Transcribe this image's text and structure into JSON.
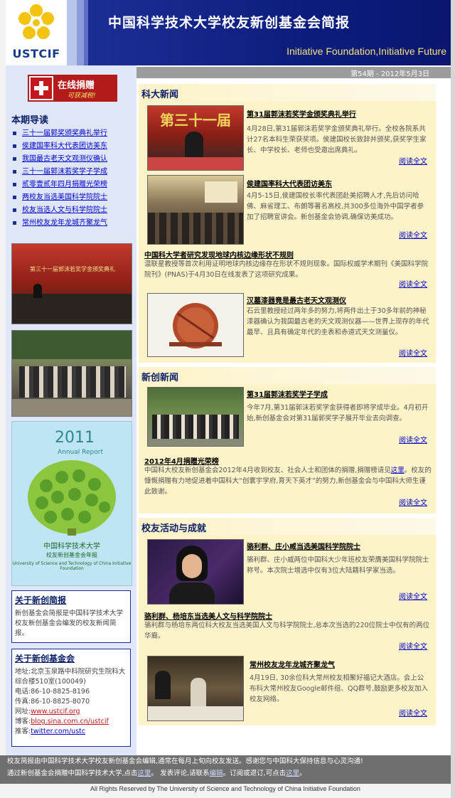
{
  "header": {
    "logo_text": "USTCIF",
    "title": "中国科学技术大学校友新创基金会简报",
    "subtitle": "Initiative Foundation,Initiative Future",
    "colors": {
      "banner": "#0b1d7c",
      "subtitle": "#f6e27a"
    }
  },
  "issue_line": "第54期 - 2012年5月3日",
  "sidebar": {
    "donate": {
      "label": "在线捐赠",
      "tagline": "可获减税!"
    },
    "toc_title": "本期导读",
    "toc_items": [
      "三十一届郭奖颁奖典礼举行",
      "侯建国率科大代表团访美东",
      "我国最古老天文观测仪确认",
      "三十一届郭沫若奖学子学成",
      "贰零壹贰年四月捐赠光荣榜",
      "两校友当选美国科学院院士",
      "校友当选人文与科学院院士",
      "常州校友龙年龙城齐聚龙气"
    ],
    "photo1_text": "第三十一届郭沫若奖学金颁奖典礼",
    "annual_report": {
      "year": "2011",
      "label": "Annual Report",
      "cn_title": "中国科学技术大学",
      "cn_sub": "校友新创基金会年报",
      "en": "University of Science and Technology of China Initiative Foundation"
    },
    "about_brief": {
      "title": "关于新创简报",
      "text": "新创基金会简报是中国科学技术大学校友新创基金会编发的校友新闻简报。"
    },
    "about_foundation": {
      "title": "关于新创基金会",
      "address_label": "地址:",
      "address": "北京玉泉路中科院研究生院科大综合楼510室(100049)",
      "phone_label": "电话:",
      "phone": "86-10-8825-8196",
      "fax_label": "传真:",
      "fax": "86-10-8825-8070",
      "web_label": "网址:",
      "web": "www.ustcif.org",
      "blog_label": "博客:",
      "blog": "blog.sina.com.cn/ustcif",
      "tweet_label": "推客:",
      "tweet": "twitter.com/ustc"
    }
  },
  "sections": {
    "s1": {
      "title": "科大新闻",
      "a1": {
        "title": "第31届郭沫若奖学金颁奖典礼举行",
        "body": "4月28日,第31届郭沫若奖学金颁奖典礼举行。全校各院系共计27名本科生荣获奖项。侯建国校长致辞并颁奖,获奖学生家长、中学校长、老师也受邀出席典礼。",
        "read": "阅读全文",
        "photo_text": "第三十一届"
      },
      "a2": {
        "title": "侯建国率科大代表团访美东",
        "body": "4月5-15日,侯建国校长率代表团赴美招聘人才,先后访问哈佛、麻省理工、布朗等著名高校,共300多位海外中国学者参加了招聘宣讲会。新创基金会协调,确保访美成功。",
        "read": "阅读全文"
      },
      "a3": {
        "title": "中国科大学者研究发现地球内核边缘形状不规则",
        "body": "温联星教授等首次利用证明地球内核边缘存在形状不规则现象。国际权威学术期刊《美国科学院院刊》(PNAS)于4月30日在线发表了这项研究成果。",
        "read": "阅读全文"
      },
      "a4": {
        "title": "汉墓漆器竟是最古老天文观测仪",
        "body": "石云里教授经过两年多的努力,将两件出土于30多年前的神秘漆器确认为我国最古老的天文观测仪器——世界上现存的年代最早、且具有确定年代的圭表和赤道式天文测量仪。",
        "read": "阅读全文"
      }
    },
    "s2": {
      "title": "新创新闻",
      "a1": {
        "title": "第31届郭沫若奖学子学成",
        "body": "今年7月,第31届郭沫若奖学金获得者即将学成毕业。4月初开始,新创基金会对第31届郭奖学子展开毕业去向调查。",
        "read": "阅读全文"
      },
      "a2": {
        "title": "2012年4月捐赠光荣榜",
        "body_1": "中国科大校友新创基金会2012年4月收到校友、社会人士和团体的捐赠,捐赠榜请见",
        "body_link": "这里",
        "body_2": "。校友的慷慨捐赠有力地促进着中国科大“创寰宇学府,育天下英才”的努力,新创基金会与中国科大师生谨此致谢。",
        "read": "阅读全文"
      }
    },
    "s3": {
      "title": "校友活动与成就",
      "a1": {
        "title": "骆利群、庄小威当选美国科学院院士",
        "body": "骆利群、庄小威两位中国科大少年班校友荣膺美国科学院院士称号。本次院士增选中仅有3位大陆籍科学家当选。",
        "read": "阅读全文"
      },
      "a2": {
        "title": "骆利群、杨培东当选美人文与科学院院士",
        "body": "骆利群与杨培东两位科大校友当选美国人文与科学院院士,总本次当选的220位院士中仅有的两位华裔。",
        "read": "阅读全文"
      },
      "a3": {
        "title": "常州校友龙年龙城齐聚龙气",
        "body": "4月19日, 30余位科大常州校友相聚好福记大酒店。会上公布科大常州校友Google邮件组、QQ群号,鼓励更多校友加入校友网络。",
        "read": "阅读全文"
      }
    }
  },
  "footer": {
    "line1": "校友简报由中国科学技术大学校友新创基金会编辑,通常在每月上旬向校友发送。感谢您与中国科大保持信息与心灵沟通!",
    "l2a": "通过新创基金会捐赠中国科学技术大学,点击",
    "l2link1": "这里",
    "l2b": "。 发表评论,请联系",
    "l2link2": "编辑",
    "l2c": "。订阅或退订,可点击",
    "l2link3": "这里",
    "l2d": "。"
  },
  "copyright": "All Rights Reserved by The University of Science and Technology of China Initiative Foundation"
}
